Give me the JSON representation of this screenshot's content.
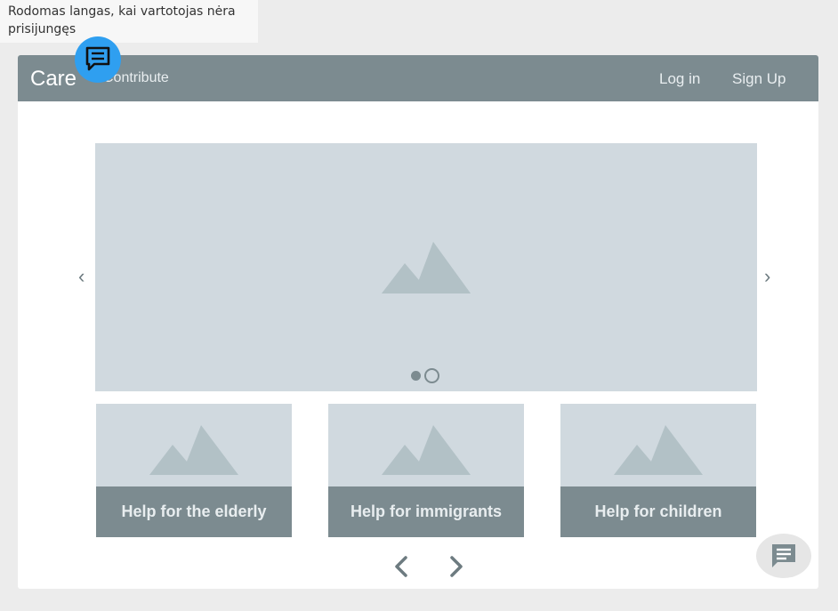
{
  "caption": "Rodomas langas, kai vartotojas nėra prisijungęs",
  "navbar": {
    "brand": "Care",
    "contribute": "Contribute",
    "login": "Log in",
    "signup": "Sign Up"
  },
  "carousel": {
    "image": "mountain-image-icon",
    "prev": "‹",
    "next": "›",
    "slide_count": 2,
    "active_slide": 1
  },
  "cards": [
    {
      "label": "Help for the elderly"
    },
    {
      "label": "Help for immigrants"
    },
    {
      "label": "Help for children"
    }
  ],
  "colors": {
    "navbar": "#7c8b90",
    "placeholder": "#d0d9df",
    "mountain": "#b2c1c6",
    "chat_badge": "#2f9ff0"
  }
}
